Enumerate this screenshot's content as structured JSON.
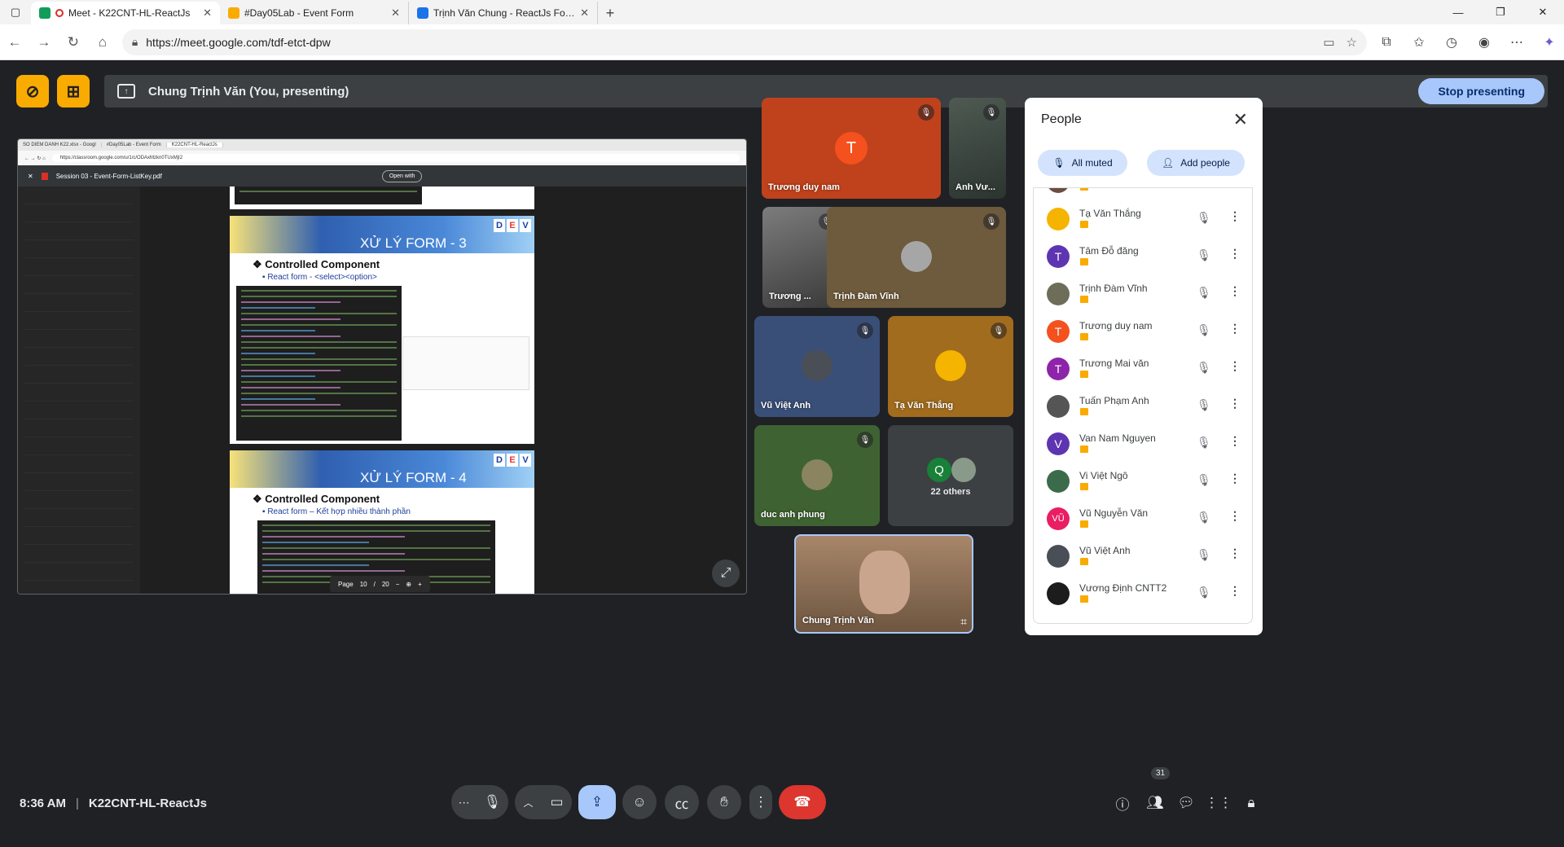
{
  "browser": {
    "tabs": [
      {
        "label": "Meet - K22CNT-HL-ReactJs",
        "fav": "#0f9d58",
        "active": true
      },
      {
        "label": "#Day05Lab - Event Form",
        "fav": "#f9ab00",
        "active": false
      },
      {
        "label": "Trịnh Văn Chung - ReactJs Form -",
        "fav": "#1a73e8",
        "active": false
      }
    ],
    "url": "https://meet.google.com/tdf-etct-dpw"
  },
  "presenting": {
    "text": "Chung Trịnh Văn (You, presenting)",
    "stop_label": "Stop presenting"
  },
  "shared_screen": {
    "tabs": [
      "SO DIEM DANH K22.xlsx - Googl",
      "#Day05Lab - Event Form",
      "K22CNT-HL-ReactJs"
    ],
    "url": "https://classroom.google.com/u/1/c/ODAxMzkn0TUxMjI2",
    "file": "Session 03 - Event-Form-ListKey.pdf",
    "open_with": "Open with",
    "slides": [
      {
        "title": "XỬ LÝ FORM - 3",
        "heading": "Controlled Component",
        "sub": "React form - <select><option>"
      },
      {
        "title": "XỬ LÝ FORM - 4",
        "heading": "Controlled Component",
        "sub": "React form – Kết hợp nhiều thành phần"
      }
    ],
    "page_label": "Page",
    "page": "10",
    "page_sep": "/",
    "page_total": "20",
    "dev": [
      "D",
      "E",
      "V"
    ]
  },
  "tiles": {
    "t1": {
      "name": "Trương duy nam",
      "initial": "T"
    },
    "t2": {
      "name": "Anh Vư..."
    },
    "t3": {
      "name": "Trương ..."
    },
    "t4": {
      "name": "Trịnh Đàm Vĩnh"
    },
    "t5": {
      "name": "Vũ Việt Anh"
    },
    "t6": {
      "name": "Tạ Văn Thắng"
    },
    "t7": {
      "name": "duc anh phung"
    },
    "others": {
      "initial": "Q",
      "label": "22 others"
    },
    "self": {
      "name": "Chung Trịnh Văn"
    }
  },
  "people": {
    "title": "People",
    "all_muted": "All muted",
    "add_people": "Add people",
    "list": [
      {
        "name": "Tạ Văn Thắng",
        "initial": "",
        "color": "#f4b400"
      },
      {
        "name": "Tâm Đỗ đăng",
        "initial": "T",
        "color": "#5e35b1"
      },
      {
        "name": "Trịnh Đàm Vĩnh",
        "initial": "",
        "color": "#6d6d5a"
      },
      {
        "name": "Trương duy nam",
        "initial": "T",
        "color": "#f4511e"
      },
      {
        "name": "Trương Mai văn",
        "initial": "T",
        "color": "#8e24aa"
      },
      {
        "name": "Tuấn Phạm Anh",
        "initial": "",
        "color": "#555555"
      },
      {
        "name": "Van Nam Nguyen",
        "initial": "V",
        "color": "#5e35b1"
      },
      {
        "name": "Vi Việt Ngô",
        "initial": "",
        "color": "#3b6b4a"
      },
      {
        "name": "Vũ Nguyễn Văn",
        "initial": "VŨ",
        "color": "#e91e63"
      },
      {
        "name": "Vũ Việt Anh",
        "initial": "",
        "color": "#4a4f57"
      },
      {
        "name": "Vương Định CNTT2",
        "initial": "",
        "color": "#1c1c1c"
      }
    ]
  },
  "bottom": {
    "time": "8:36 AM",
    "sep": "|",
    "meeting": "K22CNT-HL-ReactJs",
    "participants_count": "31"
  },
  "colors": {
    "accent": "#a8c7fa",
    "end_call": "#dc362e",
    "present_active": "#a8c7fa",
    "badge": "#f9ab00"
  }
}
